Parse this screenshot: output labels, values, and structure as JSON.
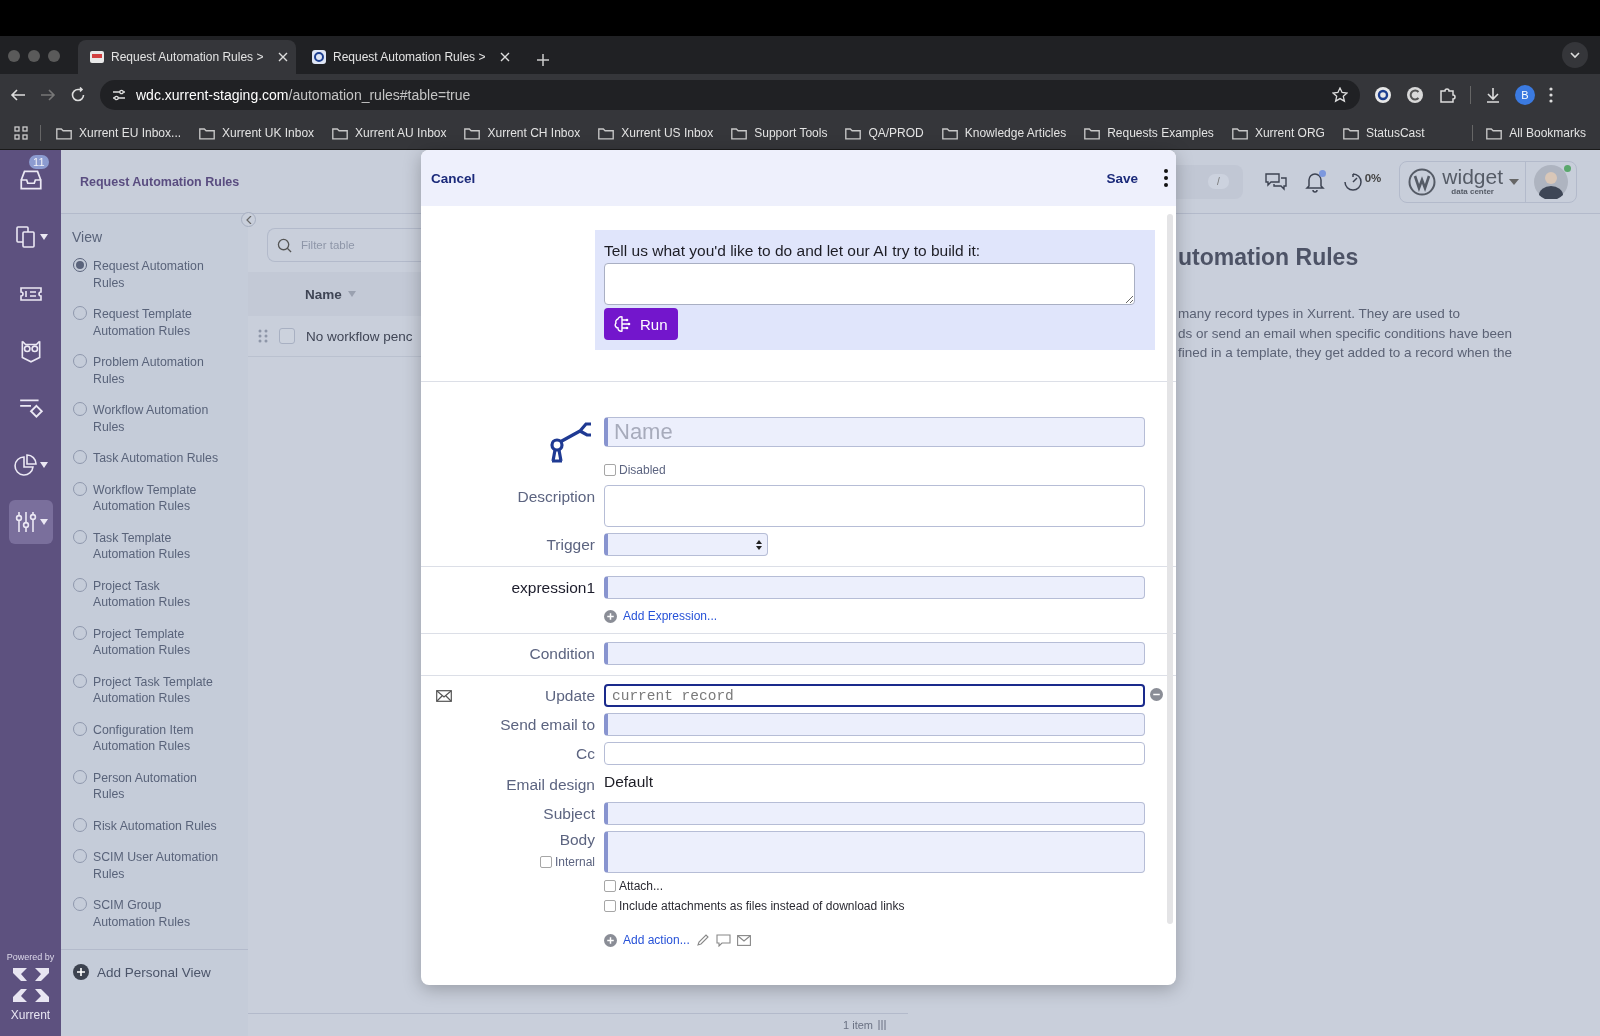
{
  "browser": {
    "tabs": [
      {
        "title": "Request Automation Rules >",
        "selected": true
      },
      {
        "title": "Request Automation Rules >",
        "selected": false
      }
    ],
    "url_host": "wdc.xurrent-staging.com",
    "url_path": "/automation_rules#table=true",
    "profile": "B",
    "bookmarks": [
      "Xurrent EU Inbox...",
      "Xurrent UK Inbox",
      "Xurrent AU Inbox",
      "Xurrent CH Inbox",
      "Xurrent US Inbox",
      "Support Tools",
      "QA/PROD",
      "Knowledge Articles",
      "Requests Examples",
      "Xurrent ORG",
      "StatusCast"
    ],
    "all_bookmarks": "All Bookmarks"
  },
  "rail": {
    "items": [
      {
        "kind": "inbox",
        "badge": "11",
        "menu": false,
        "selected": false
      },
      {
        "kind": "documents",
        "menu": true,
        "selected": false
      },
      {
        "kind": "ticket",
        "menu": false,
        "selected": false
      },
      {
        "kind": "owl",
        "menu": false,
        "selected": false
      },
      {
        "kind": "workflow",
        "menu": false,
        "selected": false
      },
      {
        "kind": "analytics",
        "menu": true,
        "selected": false
      },
      {
        "kind": "settings",
        "menu": true,
        "selected": true
      }
    ],
    "powered_by": "Powered by",
    "brand": "Xurrent"
  },
  "header": {
    "title": "Request Automation Rules",
    "search_key": "/",
    "unread": true,
    "time_percent": "0%",
    "account": {
      "name": "widget",
      "subtitle": "data center"
    },
    "online": true
  },
  "view_panel": {
    "heading": "View",
    "items": [
      {
        "label": "Request Automation Rules",
        "selected": true
      },
      {
        "label": "Request Template Automation Rules",
        "selected": false
      },
      {
        "label": "Problem Automation Rules",
        "selected": false
      },
      {
        "label": "Workflow Automation Rules",
        "selected": false
      },
      {
        "label": "Task Automation Rules",
        "selected": false
      },
      {
        "label": "Workflow Template Automation Rules",
        "selected": false
      },
      {
        "label": "Task Template Automation Rules",
        "selected": false
      },
      {
        "label": "Project Task Automation Rules",
        "selected": false
      },
      {
        "label": "Project Template Automation Rules",
        "selected": false
      },
      {
        "label": "Project Task Template Automation Rules",
        "selected": false
      },
      {
        "label": "Configuration Item Automation Rules",
        "selected": false
      },
      {
        "label": "Person Automation Rules",
        "selected": false
      },
      {
        "label": "Risk Automation Rules",
        "selected": false
      },
      {
        "label": "SCIM User Automation Rules",
        "selected": false
      },
      {
        "label": "SCIM Group Automation Rules",
        "selected": false
      }
    ],
    "add_view": "Add Personal View"
  },
  "table": {
    "filter_placeholder": "Filter table",
    "columns": [
      "Name"
    ],
    "rows": [
      {
        "name": "No workflow penc",
        "checked": false
      }
    ],
    "footer": "1 item"
  },
  "content": {
    "title": "utomation Rules",
    "lines": [
      "many record types in Xurrent. They are used to",
      "ds or send an email when specific conditions have been",
      "fined in a template, they get added to a record when the"
    ]
  },
  "modal": {
    "cancel": "Cancel",
    "save": "Save",
    "ai_prompt": "Tell us what you'd like to do and let our AI try to build it:",
    "run": "Run",
    "rows": [
      {
        "kind": "name",
        "placeholder": "Name",
        "required": true
      },
      {
        "kind": "checkbox",
        "label": "Disabled",
        "checked": false
      },
      {
        "kind": "textarea",
        "label": "Description",
        "required": false
      },
      {
        "kind": "select",
        "label": "Trigger",
        "required": true
      },
      {
        "kind": "divider"
      },
      {
        "kind": "expression",
        "label": "expression1",
        "required": true
      },
      {
        "kind": "link",
        "label": "Add Expression..."
      },
      {
        "kind": "divider"
      },
      {
        "kind": "input",
        "label": "Condition",
        "required": true
      },
      {
        "kind": "divider"
      },
      {
        "kind": "target",
        "label": "Update",
        "placeholder": "current record",
        "focused": true,
        "required": false
      },
      {
        "kind": "input",
        "label": "Send email to",
        "required": true
      },
      {
        "kind": "input",
        "label": "Cc",
        "required": false
      },
      {
        "kind": "value",
        "label": "Email design",
        "value": "Default"
      },
      {
        "kind": "input",
        "label": "Subject",
        "required": true
      },
      {
        "kind": "body",
        "label": "Body",
        "required": true,
        "internal": {
          "label": "Internal",
          "checked": false
        }
      },
      {
        "kind": "checkbox",
        "label": "Attach...",
        "checked": false
      },
      {
        "kind": "checkbox",
        "label": "Include attachments as files instead of download links",
        "checked": false
      },
      {
        "kind": "add-action",
        "label": "Add action..."
      }
    ]
  }
}
